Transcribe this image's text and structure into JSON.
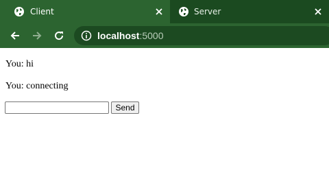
{
  "browser": {
    "tabs": [
      {
        "title": "Client",
        "active": true,
        "icon": "globe-icon"
      },
      {
        "title": "Server",
        "active": false,
        "icon": "globe-icon"
      }
    ],
    "address_bar": {
      "host": "localhost",
      "port": ":5000"
    },
    "colors": {
      "tabstrip": "#1b4a20",
      "toolbar": "#2c6430",
      "omnibox": "#1c4a21"
    }
  },
  "page": {
    "messages": [
      "You: hi",
      "You: connecting"
    ],
    "input": {
      "value": "",
      "placeholder": ""
    },
    "send_label": "Send"
  }
}
